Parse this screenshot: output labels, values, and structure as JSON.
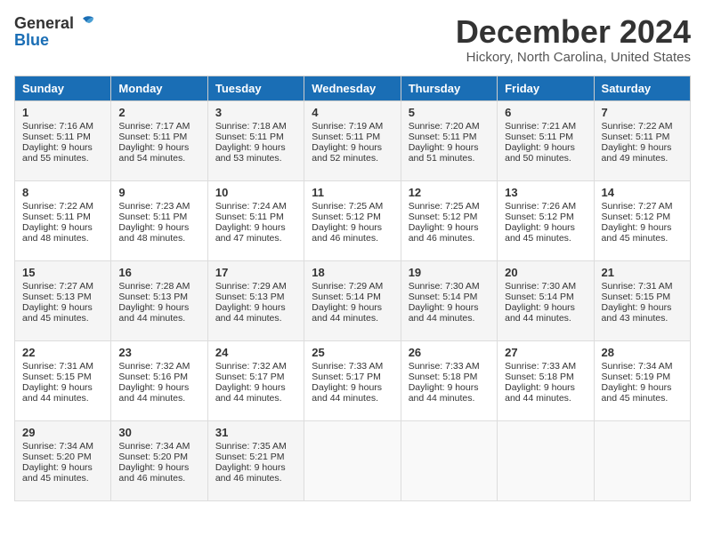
{
  "header": {
    "logo_general": "General",
    "logo_blue": "Blue",
    "month_title": "December 2024",
    "location": "Hickory, North Carolina, United States"
  },
  "days_of_week": [
    "Sunday",
    "Monday",
    "Tuesday",
    "Wednesday",
    "Thursday",
    "Friday",
    "Saturday"
  ],
  "weeks": [
    [
      {
        "day": "1",
        "sunrise": "Sunrise: 7:16 AM",
        "sunset": "Sunset: 5:11 PM",
        "daylight": "Daylight: 9 hours and 55 minutes."
      },
      {
        "day": "2",
        "sunrise": "Sunrise: 7:17 AM",
        "sunset": "Sunset: 5:11 PM",
        "daylight": "Daylight: 9 hours and 54 minutes."
      },
      {
        "day": "3",
        "sunrise": "Sunrise: 7:18 AM",
        "sunset": "Sunset: 5:11 PM",
        "daylight": "Daylight: 9 hours and 53 minutes."
      },
      {
        "day": "4",
        "sunrise": "Sunrise: 7:19 AM",
        "sunset": "Sunset: 5:11 PM",
        "daylight": "Daylight: 9 hours and 52 minutes."
      },
      {
        "day": "5",
        "sunrise": "Sunrise: 7:20 AM",
        "sunset": "Sunset: 5:11 PM",
        "daylight": "Daylight: 9 hours and 51 minutes."
      },
      {
        "day": "6",
        "sunrise": "Sunrise: 7:21 AM",
        "sunset": "Sunset: 5:11 PM",
        "daylight": "Daylight: 9 hours and 50 minutes."
      },
      {
        "day": "7",
        "sunrise": "Sunrise: 7:22 AM",
        "sunset": "Sunset: 5:11 PM",
        "daylight": "Daylight: 9 hours and 49 minutes."
      }
    ],
    [
      {
        "day": "8",
        "sunrise": "Sunrise: 7:22 AM",
        "sunset": "Sunset: 5:11 PM",
        "daylight": "Daylight: 9 hours and 48 minutes."
      },
      {
        "day": "9",
        "sunrise": "Sunrise: 7:23 AM",
        "sunset": "Sunset: 5:11 PM",
        "daylight": "Daylight: 9 hours and 48 minutes."
      },
      {
        "day": "10",
        "sunrise": "Sunrise: 7:24 AM",
        "sunset": "Sunset: 5:11 PM",
        "daylight": "Daylight: 9 hours and 47 minutes."
      },
      {
        "day": "11",
        "sunrise": "Sunrise: 7:25 AM",
        "sunset": "Sunset: 5:12 PM",
        "daylight": "Daylight: 9 hours and 46 minutes."
      },
      {
        "day": "12",
        "sunrise": "Sunrise: 7:25 AM",
        "sunset": "Sunset: 5:12 PM",
        "daylight": "Daylight: 9 hours and 46 minutes."
      },
      {
        "day": "13",
        "sunrise": "Sunrise: 7:26 AM",
        "sunset": "Sunset: 5:12 PM",
        "daylight": "Daylight: 9 hours and 45 minutes."
      },
      {
        "day": "14",
        "sunrise": "Sunrise: 7:27 AM",
        "sunset": "Sunset: 5:12 PM",
        "daylight": "Daylight: 9 hours and 45 minutes."
      }
    ],
    [
      {
        "day": "15",
        "sunrise": "Sunrise: 7:27 AM",
        "sunset": "Sunset: 5:13 PM",
        "daylight": "Daylight: 9 hours and 45 minutes."
      },
      {
        "day": "16",
        "sunrise": "Sunrise: 7:28 AM",
        "sunset": "Sunset: 5:13 PM",
        "daylight": "Daylight: 9 hours and 44 minutes."
      },
      {
        "day": "17",
        "sunrise": "Sunrise: 7:29 AM",
        "sunset": "Sunset: 5:13 PM",
        "daylight": "Daylight: 9 hours and 44 minutes."
      },
      {
        "day": "18",
        "sunrise": "Sunrise: 7:29 AM",
        "sunset": "Sunset: 5:14 PM",
        "daylight": "Daylight: 9 hours and 44 minutes."
      },
      {
        "day": "19",
        "sunrise": "Sunrise: 7:30 AM",
        "sunset": "Sunset: 5:14 PM",
        "daylight": "Daylight: 9 hours and 44 minutes."
      },
      {
        "day": "20",
        "sunrise": "Sunrise: 7:30 AM",
        "sunset": "Sunset: 5:14 PM",
        "daylight": "Daylight: 9 hours and 44 minutes."
      },
      {
        "day": "21",
        "sunrise": "Sunrise: 7:31 AM",
        "sunset": "Sunset: 5:15 PM",
        "daylight": "Daylight: 9 hours and 43 minutes."
      }
    ],
    [
      {
        "day": "22",
        "sunrise": "Sunrise: 7:31 AM",
        "sunset": "Sunset: 5:15 PM",
        "daylight": "Daylight: 9 hours and 44 minutes."
      },
      {
        "day": "23",
        "sunrise": "Sunrise: 7:32 AM",
        "sunset": "Sunset: 5:16 PM",
        "daylight": "Daylight: 9 hours and 44 minutes."
      },
      {
        "day": "24",
        "sunrise": "Sunrise: 7:32 AM",
        "sunset": "Sunset: 5:17 PM",
        "daylight": "Daylight: 9 hours and 44 minutes."
      },
      {
        "day": "25",
        "sunrise": "Sunrise: 7:33 AM",
        "sunset": "Sunset: 5:17 PM",
        "daylight": "Daylight: 9 hours and 44 minutes."
      },
      {
        "day": "26",
        "sunrise": "Sunrise: 7:33 AM",
        "sunset": "Sunset: 5:18 PM",
        "daylight": "Daylight: 9 hours and 44 minutes."
      },
      {
        "day": "27",
        "sunrise": "Sunrise: 7:33 AM",
        "sunset": "Sunset: 5:18 PM",
        "daylight": "Daylight: 9 hours and 44 minutes."
      },
      {
        "day": "28",
        "sunrise": "Sunrise: 7:34 AM",
        "sunset": "Sunset: 5:19 PM",
        "daylight": "Daylight: 9 hours and 45 minutes."
      }
    ],
    [
      {
        "day": "29",
        "sunrise": "Sunrise: 7:34 AM",
        "sunset": "Sunset: 5:20 PM",
        "daylight": "Daylight: 9 hours and 45 minutes."
      },
      {
        "day": "30",
        "sunrise": "Sunrise: 7:34 AM",
        "sunset": "Sunset: 5:20 PM",
        "daylight": "Daylight: 9 hours and 46 minutes."
      },
      {
        "day": "31",
        "sunrise": "Sunrise: 7:35 AM",
        "sunset": "Sunset: 5:21 PM",
        "daylight": "Daylight: 9 hours and 46 minutes."
      },
      {
        "day": "",
        "sunrise": "",
        "sunset": "",
        "daylight": ""
      },
      {
        "day": "",
        "sunrise": "",
        "sunset": "",
        "daylight": ""
      },
      {
        "day": "",
        "sunrise": "",
        "sunset": "",
        "daylight": ""
      },
      {
        "day": "",
        "sunrise": "",
        "sunset": "",
        "daylight": ""
      }
    ]
  ]
}
